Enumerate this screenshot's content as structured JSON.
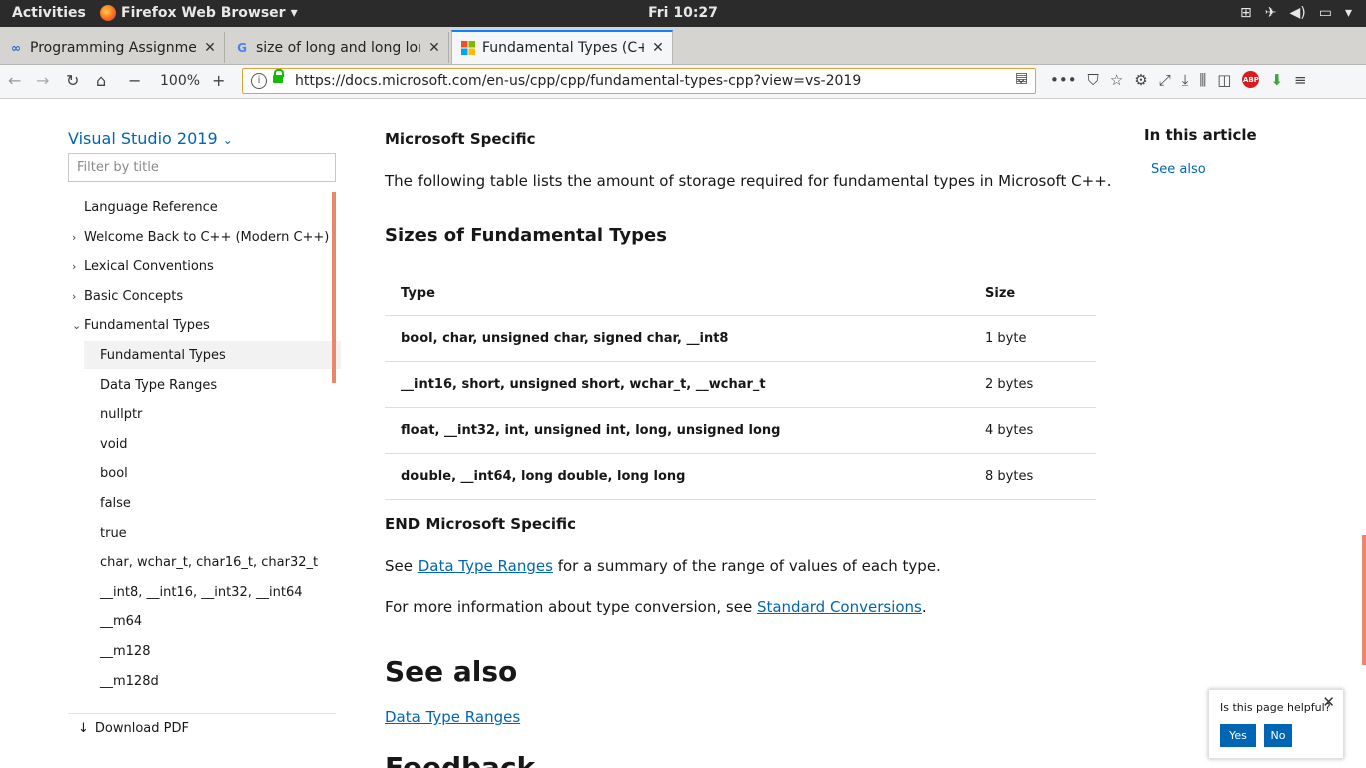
{
  "topbar": {
    "activities": "Activities",
    "app_name": "Firefox Web Browser",
    "clock": "Fri 10:27"
  },
  "tabs": [
    {
      "title": "Programming Assignment",
      "icon": "infinity-icon"
    },
    {
      "title": "size of long and long long",
      "icon": "google-g-icon"
    },
    {
      "title": "Fundamental Types (C++)",
      "icon": "microsoft-logo-icon"
    }
  ],
  "navbar": {
    "zoom": "100%",
    "url": "https://docs.microsoft.com/en-us/cpp/cpp/fundamental-types-cpp?view=vs-2019"
  },
  "sidebar": {
    "version": "Visual Studio 2019",
    "filter_placeholder": "Filter by title",
    "items": [
      {
        "label": "Language Reference"
      },
      {
        "label": "Welcome Back to C++ (Modern C++)"
      },
      {
        "label": "Lexical Conventions"
      },
      {
        "label": "Basic Concepts"
      },
      {
        "label": "Fundamental Types"
      },
      {
        "label": "Fundamental Types"
      },
      {
        "label": "Data Type Ranges"
      },
      {
        "label": "nullptr"
      },
      {
        "label": "void"
      },
      {
        "label": "bool"
      },
      {
        "label": "false"
      },
      {
        "label": "true"
      },
      {
        "label": "char, wchar_t, char16_t, char32_t"
      },
      {
        "label": "__int8, __int16, __int32, __int64"
      },
      {
        "label": "__m64"
      },
      {
        "label": "__m128"
      },
      {
        "label": "__m128d"
      }
    ],
    "download_pdf": "Download PDF"
  },
  "article": {
    "microsoft_specific": "Microsoft Specific",
    "intro": "The following table lists the amount of storage required for fundamental types in Microsoft C++.",
    "table_title": "Sizes of Fundamental Types",
    "table": {
      "headers": [
        "Type",
        "Size"
      ],
      "rows": [
        [
          "bool, char, unsigned char, signed char, __int8",
          "1 byte"
        ],
        [
          "__int16, short, unsigned short, wchar_t, __wchar_t",
          "2 bytes"
        ],
        [
          "float, __int32, int, unsigned int, long, unsigned long",
          "4 bytes"
        ],
        [
          "double, __int64, long double, long long",
          "8 bytes"
        ]
      ]
    },
    "end_microsoft_specific": "END Microsoft Specific",
    "see_pre": "See ",
    "see_link": "Data Type Ranges",
    "see_post": " for a summary of the range of values of each type.",
    "more_pre": "For more information about type conversion, see ",
    "more_link": "Standard Conversions",
    "more_post": ".",
    "see_also_heading": "See also",
    "see_also_link": "Data Type Ranges",
    "feedback_heading": "Feedback"
  },
  "in_this_article": {
    "heading": "In this article",
    "link": "See also"
  },
  "helpful": {
    "question": "Is this page helpful?",
    "yes": "Yes",
    "no": "No"
  }
}
